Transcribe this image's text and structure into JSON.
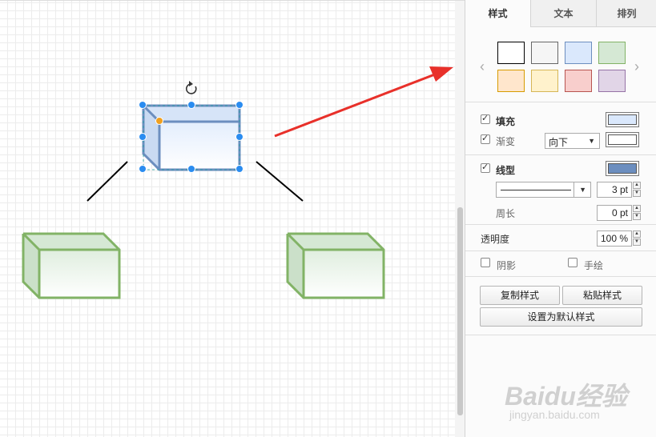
{
  "tabs": [
    {
      "label": "样式",
      "active": true
    },
    {
      "label": "文本",
      "active": false
    },
    {
      "label": "排列",
      "active": false
    }
  ],
  "swatches": [
    {
      "fill": "#ffffff",
      "stroke": "#000000"
    },
    {
      "fill": "#f5f5f5",
      "stroke": "#666666"
    },
    {
      "fill": "#dae8fc",
      "stroke": "#6c8ebf"
    },
    {
      "fill": "#d5e8d4",
      "stroke": "#82b366"
    },
    {
      "fill": "#ffe6cc",
      "stroke": "#d79b00"
    },
    {
      "fill": "#fff2cc",
      "stroke": "#d6b656"
    },
    {
      "fill": "#f8cecc",
      "stroke": "#b85450"
    },
    {
      "fill": "#e1d5e7",
      "stroke": "#9673a6"
    }
  ],
  "fill": {
    "label": "填充",
    "checked": true,
    "color": "#dae8fc"
  },
  "gradient": {
    "label": "渐变",
    "checked": true,
    "direction": "向下",
    "color": "#ffffff"
  },
  "line": {
    "label": "线型",
    "checked": true,
    "color": "#6c8ebf",
    "width_value": "3 pt"
  },
  "perimeter": {
    "label": "周长",
    "value": "0 pt"
  },
  "opacity": {
    "label": "透明度",
    "value": "100 %"
  },
  "shadow": {
    "label": "阴影",
    "checked": false
  },
  "sketch": {
    "label": "手绘",
    "checked": false
  },
  "buttons": {
    "copy_style": "复制样式",
    "paste_style": "粘贴样式",
    "set_default": "设置为默认样式"
  },
  "canvas": {
    "selected_shape": {
      "type": "cube",
      "fill_top": "#dae8fc",
      "fill_bottom": "#ffffff",
      "stroke": "#6c8ebf"
    },
    "other_shapes": {
      "type": "cube",
      "fill_top": "#d5e8d4",
      "fill_bottom": "#ffffff",
      "stroke": "#82b366"
    },
    "annotation_arrow_color": "#e8302a"
  },
  "watermark": {
    "brand": "Baidu经验",
    "url": "jingyan.baidu.com"
  }
}
